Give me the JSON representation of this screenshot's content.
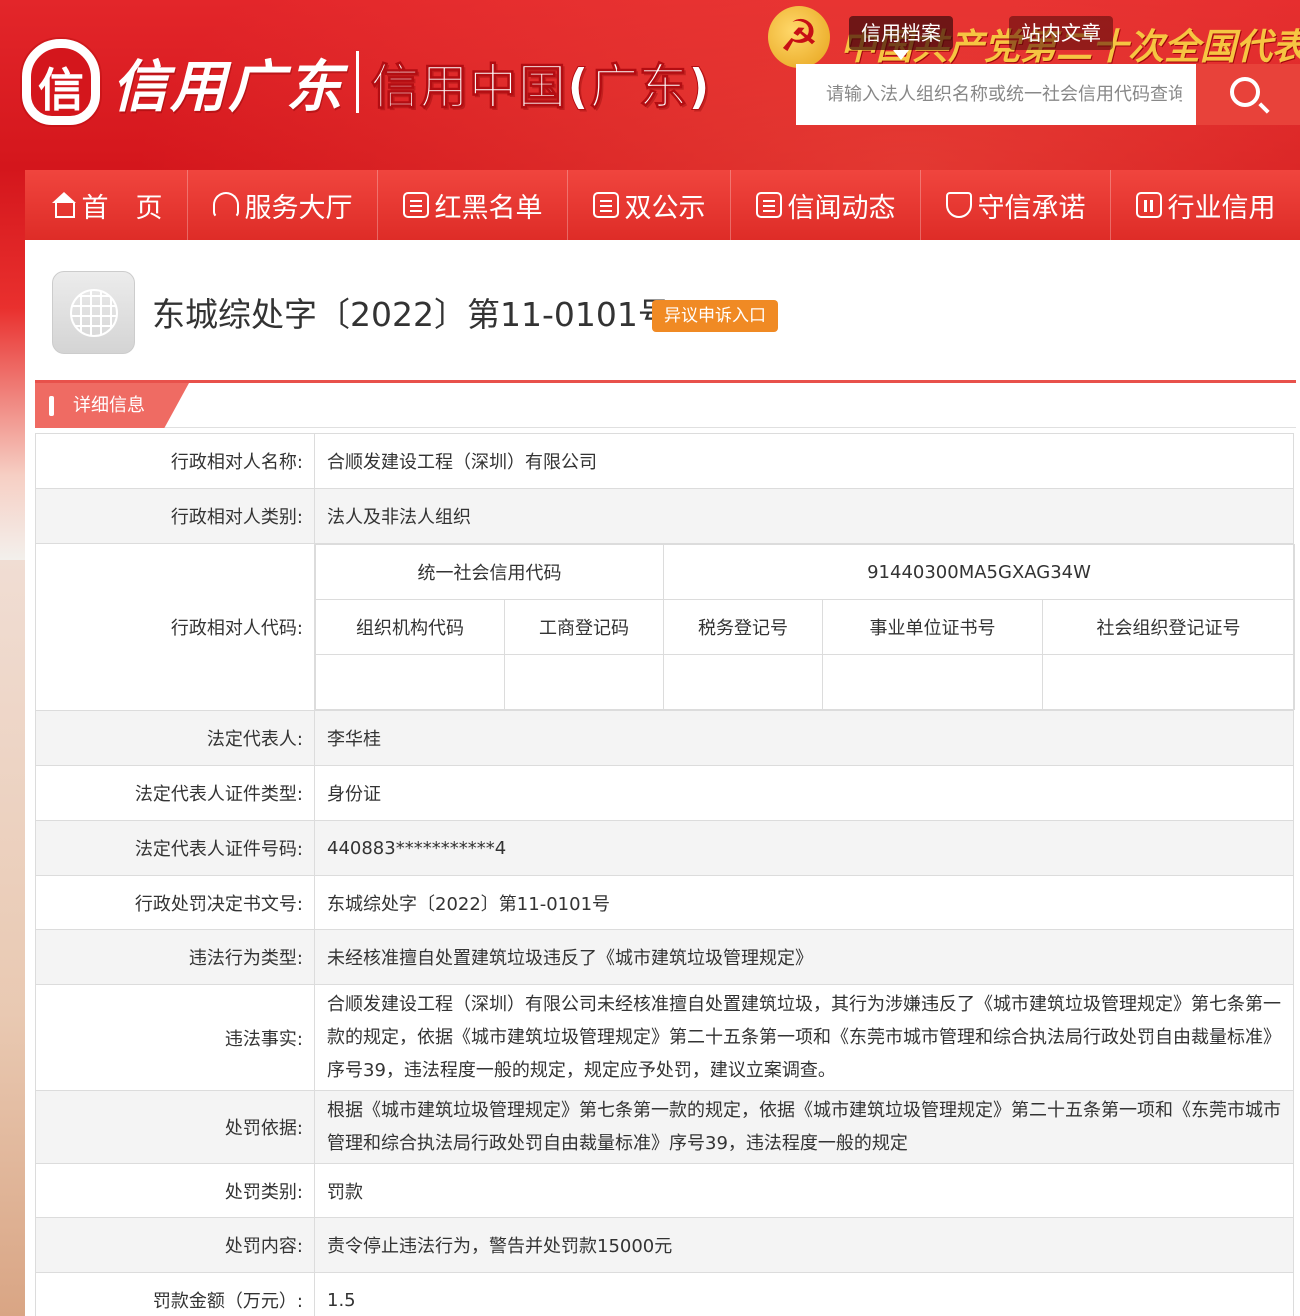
{
  "header": {
    "logo_mark": "信",
    "logo_script": "信用广东",
    "logo_sub": "信用中国(广东)",
    "party_emblem": "☭",
    "slogan": "中国共产党第二十次全国代表",
    "tabs": [
      {
        "label": "信用档案",
        "active": true
      },
      {
        "label": "站内文章",
        "active": false
      }
    ],
    "search": {
      "placeholder": "请输入法人组织名称或统一社会信用代码查询",
      "value": ""
    }
  },
  "nav": {
    "items": [
      {
        "label": "首　页",
        "icon": "home-icon"
      },
      {
        "label": "服务大厅",
        "icon": "headset-icon"
      },
      {
        "label": "红黑名单",
        "icon": "list-icon"
      },
      {
        "label": "双公示",
        "icon": "bulletin-icon"
      },
      {
        "label": "信闻动态",
        "icon": "news-icon"
      },
      {
        "label": "守信承诺",
        "icon": "shield-icon"
      },
      {
        "label": "行业信用",
        "icon": "building-icon"
      }
    ]
  },
  "record": {
    "title": "东城综处字〔2022〕第11-0101号",
    "appeal_label": "异议申诉入口",
    "section_label": "详细信息"
  },
  "detail": {
    "subject_name_label": "行政相对人名称:",
    "subject_name": "合顺发建设工程（深圳）有限公司",
    "subject_type_label": "行政相对人类别:",
    "subject_type": "法人及非法人组织",
    "subject_code_label": "行政相对人代码:",
    "codes": {
      "uscc_label": "统一社会信用代码",
      "uscc_value": "91440300MA5GXAG34W",
      "headers": [
        "组织机构代码",
        "工商登记码",
        "税务登记号",
        "事业单位证书号",
        "社会组织登记证号"
      ],
      "values": [
        "",
        "",
        "",
        "",
        ""
      ]
    },
    "legal_rep_label": "法定代表人:",
    "legal_rep": "李华桂",
    "legal_rep_id_type_label": "法定代表人证件类型:",
    "legal_rep_id_type": "身份证",
    "legal_rep_id_no_label": "法定代表人证件号码:",
    "legal_rep_id_no": "440883***********4",
    "decision_no_label": "行政处罚决定书文号:",
    "decision_no": "东城综处字〔2022〕第11-0101号",
    "violation_type_label": "违法行为类型:",
    "violation_type": "未经核准擅自处置建筑垃圾违反了《城市建筑垃圾管理规定》",
    "violation_facts_label": "违法事实:",
    "violation_facts": "合顺发建设工程（深圳）有限公司未经核准擅自处置建筑垃圾，其行为涉嫌违反了《城市建筑垃圾管理规定》第七条第一款的规定，依据《城市建筑垃圾管理规定》第二十五条第一项和《东莞市城市管理和综合执法局行政处罚自由裁量标准》序号39，违法程度一般的规定，规定应予处罚，建议立案调查。",
    "penalty_basis_label": "处罚依据:",
    "penalty_basis": "根据《城市建筑垃圾管理规定》第七条第一款的规定，依据《城市建筑垃圾管理规定》第二十五条第一项和《东莞市城市管理和综合执法局行政处罚自由裁量标准》序号39，违法程度一般的规定",
    "penalty_category_label": "处罚类别:",
    "penalty_category": "罚款",
    "penalty_content_label": "处罚内容:",
    "penalty_content": "责令停止违法行为，警告并处罚款15000元",
    "fine_amount_label": "罚款金额（万元）:",
    "fine_amount": "1.5"
  }
}
